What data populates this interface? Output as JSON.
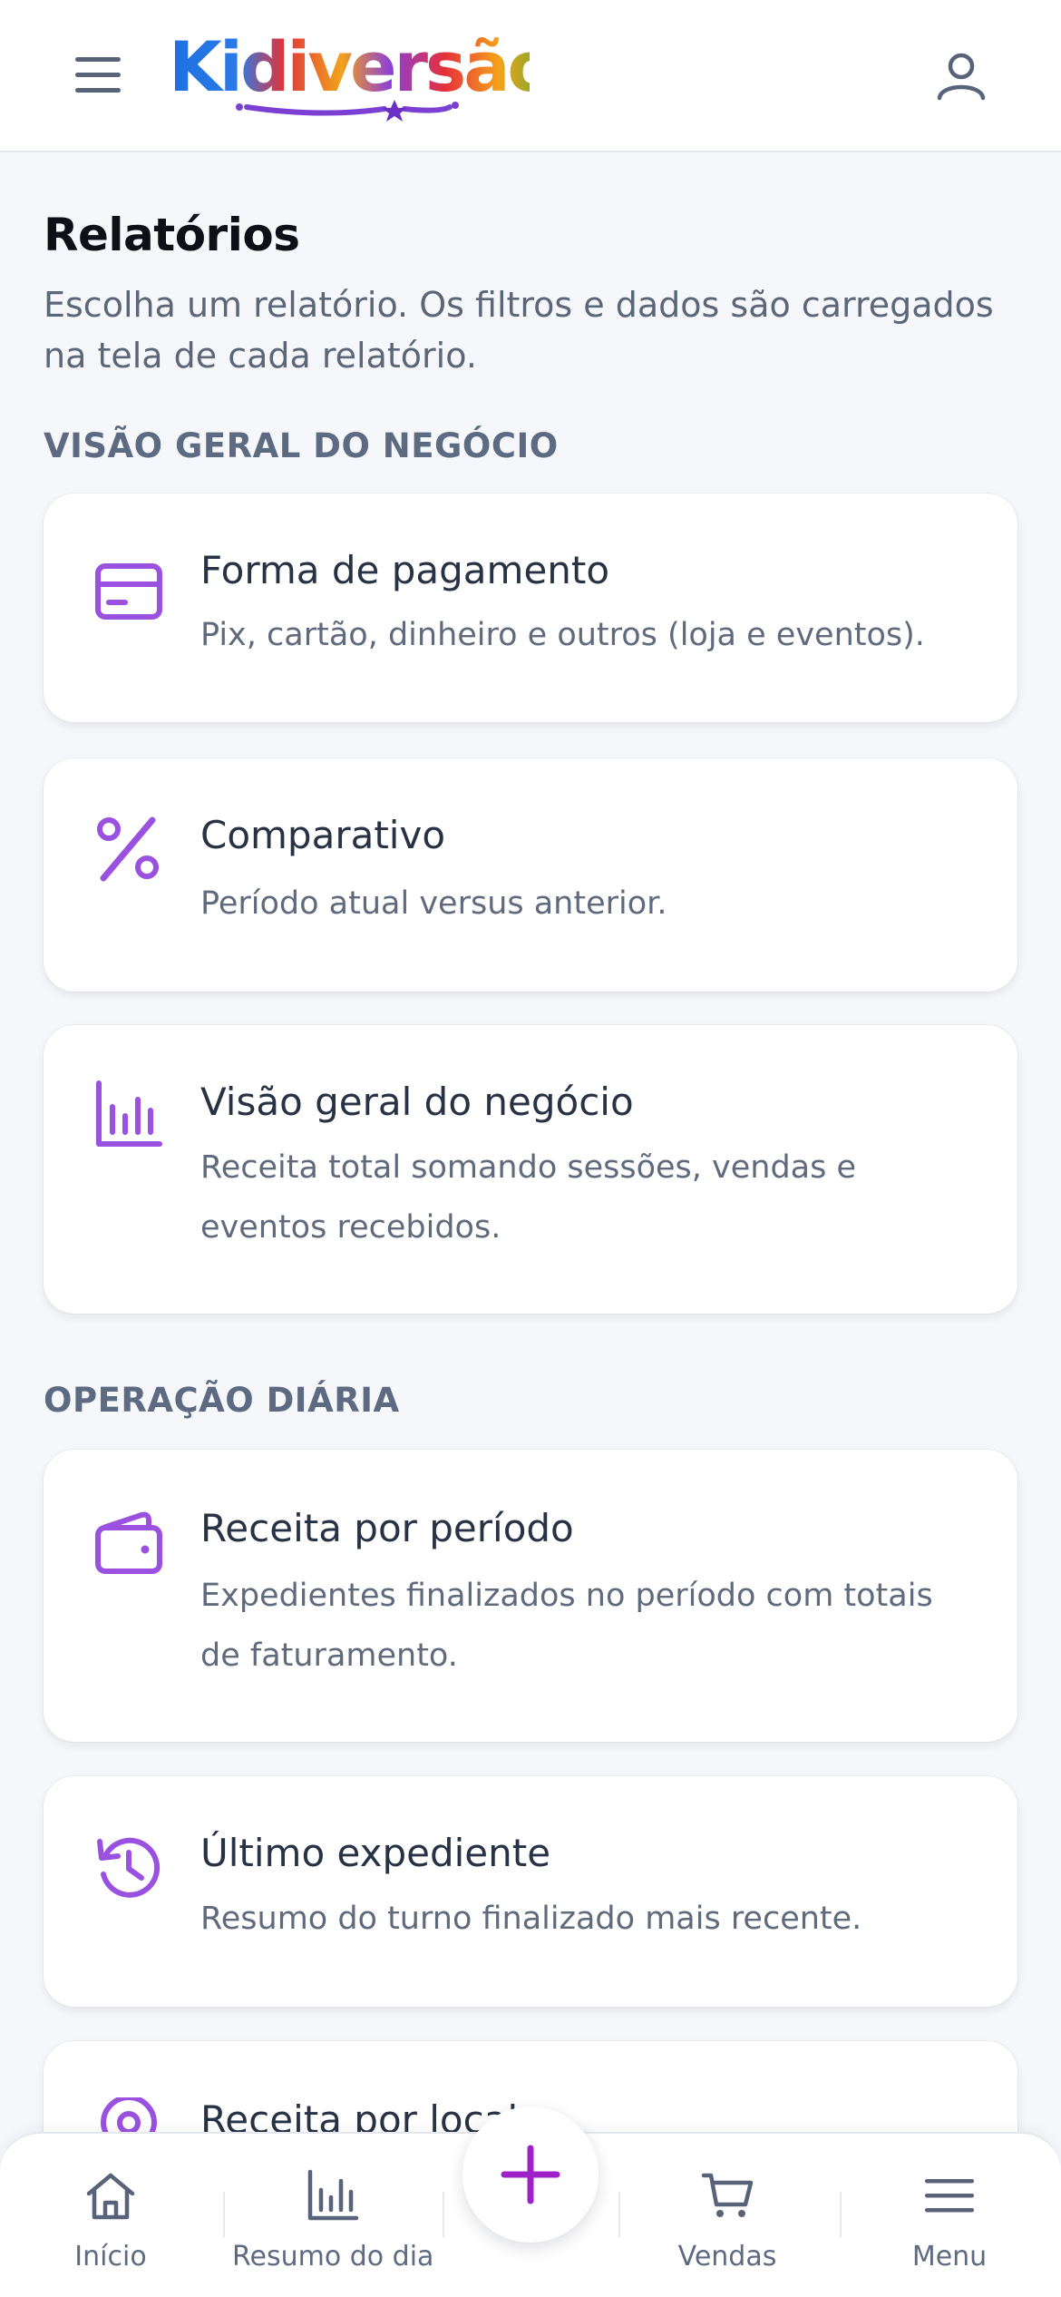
{
  "header": {
    "logo_text": "Kidiversão",
    "menu_icon": "hamburger-menu-icon",
    "user_icon": "user-icon"
  },
  "page": {
    "title": "Relatórios",
    "subtitle": "Escolha um relatório. Os filtros e dados são carregados na tela de cada relatório."
  },
  "sections": [
    {
      "label": "VISÃO GERAL DO NEGÓCIO",
      "cards": [
        {
          "icon": "credit-card-icon",
          "title": "Forma de pagamento",
          "desc": "Pix, cartão, dinheiro e outros (loja e eventos)."
        },
        {
          "icon": "percent-icon",
          "title": "Comparativo",
          "desc": "Período atual versus anterior."
        },
        {
          "icon": "bar-chart-icon",
          "title": "Visão geral do negócio",
          "desc": "Receita total somando sessões, vendas e eventos recebidos."
        }
      ]
    },
    {
      "label": "OPERAÇÃO DIÁRIA",
      "cards": [
        {
          "icon": "wallet-icon",
          "title": "Receita por período",
          "desc": "Expedientes finalizados no período com totais de faturamento."
        },
        {
          "icon": "history-icon",
          "title": "Último expediente",
          "desc": "Resumo do turno finalizado mais recente."
        },
        {
          "icon": "location-pin-icon",
          "title": "Receita por local",
          "desc": ""
        }
      ]
    }
  ],
  "bottom_nav": {
    "items": [
      {
        "icon": "home-icon",
        "label": "Início"
      },
      {
        "icon": "bar-chart-icon",
        "label": "Resumo do dia"
      },
      {
        "icon": "cart-icon",
        "label": "Vendas"
      },
      {
        "icon": "hamburger-menu-icon",
        "label": "Menu"
      }
    ],
    "fab_icon": "plus-icon"
  },
  "colors": {
    "accent": "#9b51e0",
    "fab_plus": "#a020c8",
    "text_dark": "#0d1117",
    "text_muted": "#5f6b7d",
    "section_label": "#5d6b82",
    "background": "#f6f7fa"
  }
}
